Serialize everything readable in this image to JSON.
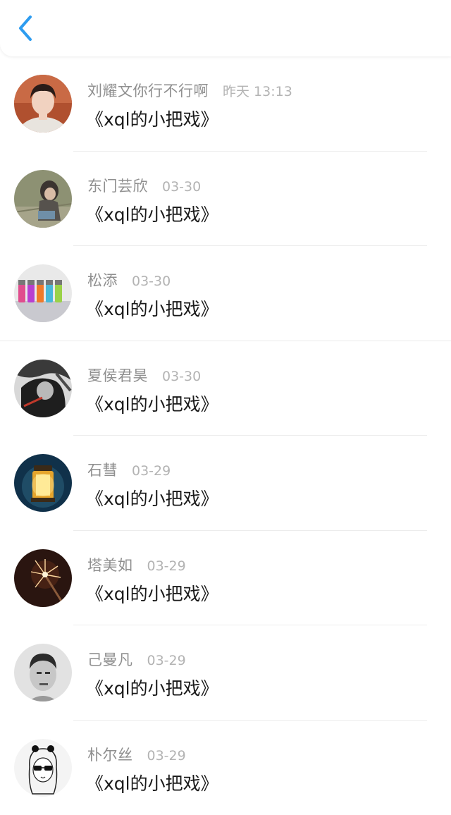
{
  "header": {
    "back_icon": "chevron-left-icon",
    "accent_color": "#2d9cf0"
  },
  "comments": [
    {
      "name": "刘耀文你行不行啊",
      "time": "昨天 13:13",
      "content": "《xql的小把戏》",
      "avatar": "portrait-young-man"
    },
    {
      "name": "东门芸欣",
      "time": "03-30",
      "content": "《xql的小把戏》",
      "avatar": "person-sitting-reading"
    },
    {
      "name": "松添",
      "time": "03-30",
      "content": "《xql的小把戏》",
      "avatar": "colorful-vials"
    },
    {
      "name": "夏侯君昊",
      "time": "03-30",
      "content": "《xql的小把戏》",
      "avatar": "dark-anime-character"
    },
    {
      "name": "石彗",
      "time": "03-29",
      "content": "《xql的小把戏》",
      "avatar": "glowing-lantern"
    },
    {
      "name": "塔美如",
      "time": "03-29",
      "content": "《xql的小把戏》",
      "avatar": "sparkler"
    },
    {
      "name": "己曼凡",
      "time": "03-29",
      "content": "《xql的小把戏》",
      "avatar": "grayscale-man-portrait"
    },
    {
      "name": "朴尔丝",
      "time": "03-29",
      "content": "《xql的小把戏》",
      "avatar": "sketch-girl-sunglasses"
    }
  ]
}
